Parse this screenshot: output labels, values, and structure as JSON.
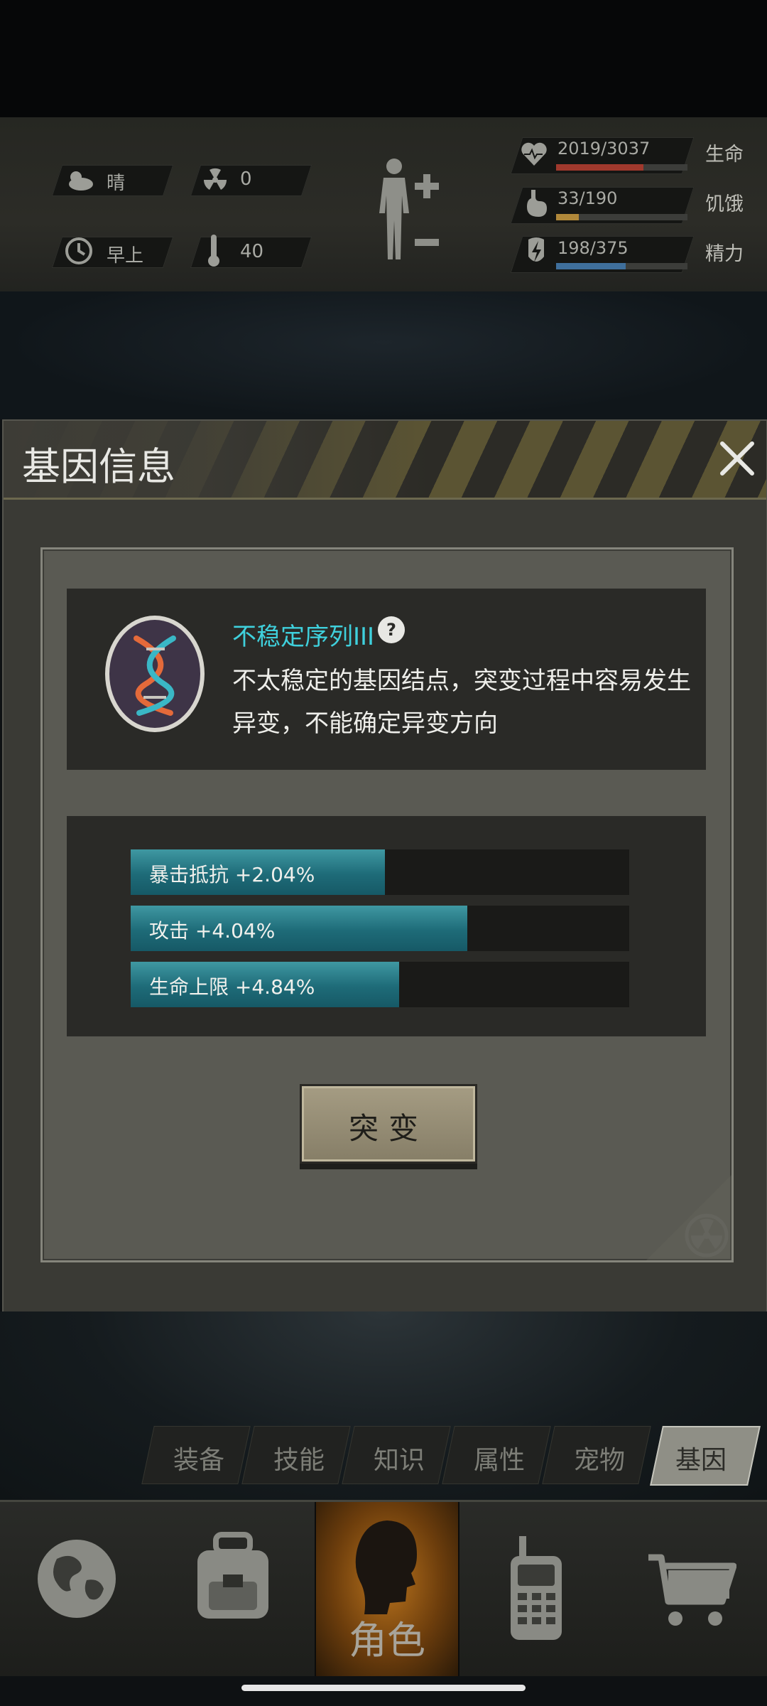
{
  "status": {
    "weather": "晴",
    "radiation": "0",
    "time_of_day": "早上",
    "temperature": "40",
    "health": {
      "value": "2019/3037",
      "label": "生命",
      "fraction": 0.666,
      "color": "#a0392d"
    },
    "hunger": {
      "value": "33/190",
      "label": "饥饿",
      "fraction": 0.174,
      "color": "#b0883a"
    },
    "energy": {
      "value": "198/375",
      "label": "精力",
      "fraction": 0.528,
      "color": "#3f6f9c"
    }
  },
  "dialog": {
    "title": "基因信息",
    "gene": {
      "name": "不稳定序列III",
      "description": "不太稳定的基因结点，突变过程中容易发生异变，不能确定异变方向"
    },
    "stats": [
      {
        "label": "暴击抵抗 +2.04%",
        "fraction": 0.51
      },
      {
        "label": "攻击 +4.04%",
        "fraction": 0.675
      },
      {
        "label": "生命上限 +4.84%",
        "fraction": 0.538
      }
    ],
    "mutate_button": "突变"
  },
  "tabs": [
    "装备",
    "技能",
    "知识",
    "属性",
    "宠物",
    "基因"
  ],
  "active_tab": "基因",
  "nav": {
    "role_label": "角色"
  }
}
